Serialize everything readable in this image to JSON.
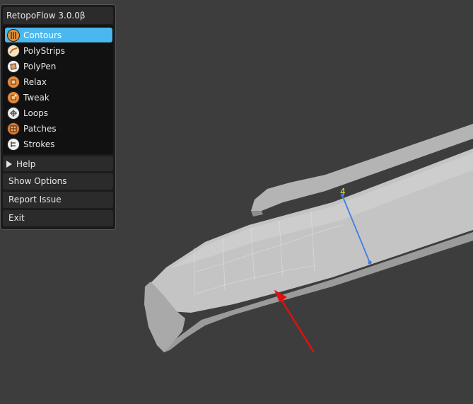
{
  "panel": {
    "title": "RetopoFlow 3.0.0β",
    "tools": [
      {
        "label": "Contours",
        "icon": "contours-icon",
        "active": true
      },
      {
        "label": "PolyStrips",
        "icon": "polystrips-icon",
        "active": false
      },
      {
        "label": "PolyPen",
        "icon": "polypen-icon",
        "active": false
      },
      {
        "label": "Relax",
        "icon": "relax-icon",
        "active": false
      },
      {
        "label": "Tweak",
        "icon": "tweak-icon",
        "active": false
      },
      {
        "label": "Loops",
        "icon": "loops-icon",
        "active": false
      },
      {
        "label": "Patches",
        "icon": "patches-icon",
        "active": false
      },
      {
        "label": "Strokes",
        "icon": "strokes-icon",
        "active": false
      }
    ],
    "help_label": "Help",
    "show_options_label": "Show Options",
    "report_issue_label": "Report Issue",
    "exit_label": "Exit"
  },
  "viewport": {
    "contour_count": "4"
  },
  "colors": {
    "background": "#3d3d3d",
    "active_tool": "#4ab8f0",
    "contour_stroke": "#3d7fe6",
    "arrow": "#e01010",
    "count_label": "#e8e34a"
  }
}
